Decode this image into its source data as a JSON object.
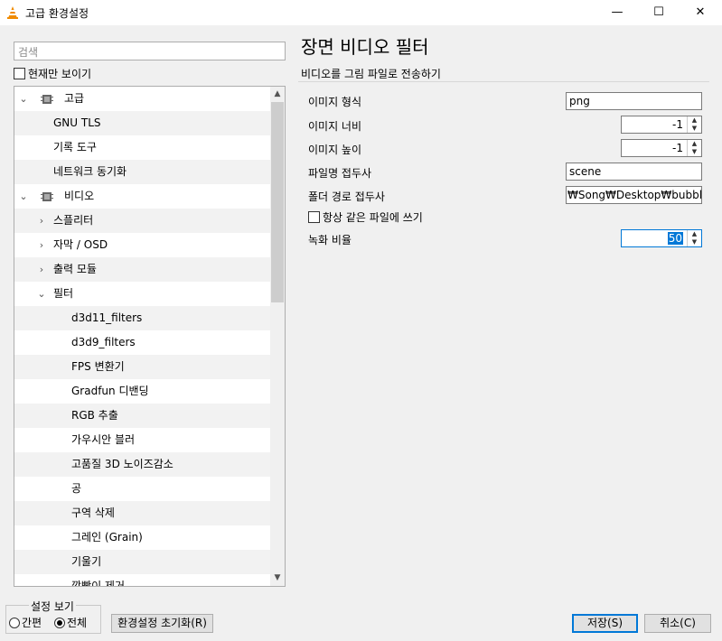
{
  "window": {
    "title": "고급 환경설정",
    "minimize": "—",
    "maximize": "☐",
    "close": "✕"
  },
  "search": {
    "placeholder": "검색"
  },
  "only_current": {
    "label": "현재만 보이기",
    "checked": false
  },
  "tree": {
    "items": [
      {
        "label": "고급",
        "level": 0,
        "expanded": true,
        "icon": "chip-icon"
      },
      {
        "label": "GNU TLS",
        "level": 1
      },
      {
        "label": "기록 도구",
        "level": 1
      },
      {
        "label": "네트워크 동기화",
        "level": 1
      },
      {
        "label": "비디오",
        "level": 0,
        "expanded": true,
        "icon": "video-settings-icon"
      },
      {
        "label": "스플리터",
        "level": 1,
        "expandable": true
      },
      {
        "label": "자막 / OSD",
        "level": 1,
        "expandable": true
      },
      {
        "label": "출력 모듈",
        "level": 1,
        "expandable": true
      },
      {
        "label": "필터",
        "level": 1,
        "expanded": true
      },
      {
        "label": "d3d11_filters",
        "level": 2
      },
      {
        "label": "d3d9_filters",
        "level": 2
      },
      {
        "label": "FPS 변환기",
        "level": 2
      },
      {
        "label": "Gradfun 디밴딩",
        "level": 2
      },
      {
        "label": "RGB 추출",
        "level": 2
      },
      {
        "label": "가우시안 블러",
        "level": 2
      },
      {
        "label": "고품질 3D 노이즈감소",
        "level": 2
      },
      {
        "label": "공",
        "level": 2
      },
      {
        "label": "구역 삭제",
        "level": 2
      },
      {
        "label": "그레인 (Grain)",
        "level": 2
      },
      {
        "label": "기울기",
        "level": 2
      },
      {
        "label": "깜빡이 제거",
        "level": 2
      }
    ]
  },
  "panel": {
    "title": "장면 비디오 필터",
    "subtitle": "비디오를 그림 파일로 전송하기",
    "options": {
      "format": {
        "label": "이미지 형식",
        "value": "png"
      },
      "width": {
        "label": "이미지 너비",
        "value": "-1"
      },
      "height": {
        "label": "이미지 높이",
        "value": "-1"
      },
      "prefix": {
        "label": "파일명 접두사",
        "value": "scene"
      },
      "path": {
        "label": "폴더 경로 접두사",
        "value": "₩Song₩Desktop₩bubble"
      },
      "replace": {
        "label": "항상 같은 파일에 쓰기",
        "checked": false
      },
      "ratio": {
        "label": "녹화 비율",
        "value": "50"
      }
    }
  },
  "footer": {
    "view_legend": "설정 보기",
    "simple": "간편",
    "all": "전체",
    "selected_view": "all",
    "reset": "환경설정 초기화(R)",
    "save": "저장(S)",
    "cancel": "취소(C)"
  },
  "colors": {
    "accent": "#0078d7",
    "cone_orange": "#f08a00"
  }
}
